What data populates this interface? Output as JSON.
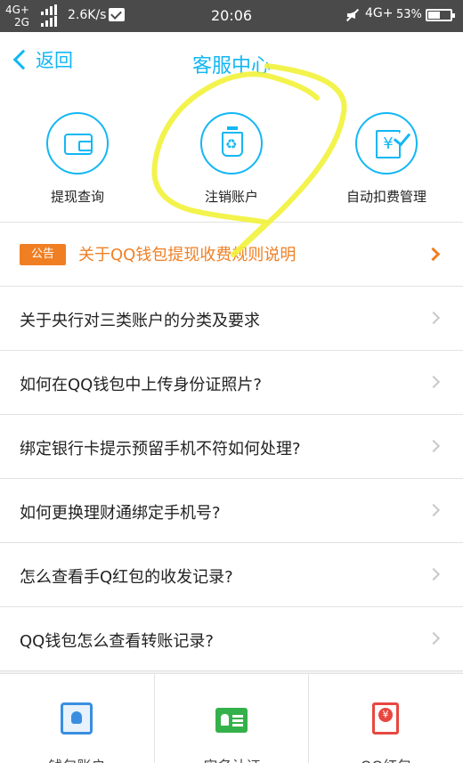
{
  "status_bar": {
    "network_left_1": "4G+",
    "network_left_2": "2G",
    "speed": "2.6K/s",
    "time": "20:06",
    "network_right": "4G+",
    "battery": "53%"
  },
  "header": {
    "back_label": "返回",
    "title": "客服中心"
  },
  "quick_actions": [
    {
      "label": "提现查询",
      "icon": "wallet-icon"
    },
    {
      "label": "注销账户",
      "icon": "recycle-bin-icon"
    },
    {
      "label": "自动扣费管理",
      "icon": "yuan-bill-icon"
    }
  ],
  "notice": {
    "badge": "公告",
    "text": "关于QQ钱包提现收费规则说明"
  },
  "faq": [
    "关于央行对三类账户的分类及要求",
    "如何在QQ钱包中上传身份证照片?",
    "绑定银行卡提示预留手机不符如何处理?",
    "如何更换理财通绑定手机号?",
    "怎么查看手Q红包的收发记录?",
    "QQ钱包怎么查看转账记录?"
  ],
  "bottom_nav": [
    {
      "label": "钱包账户",
      "icon": "wallet-account-icon"
    },
    {
      "label": "实名认证",
      "icon": "id-card-icon"
    },
    {
      "label": "QQ红包",
      "icon": "red-packet-icon"
    }
  ],
  "colors": {
    "accent": "#12b7f5",
    "notice": "#f07f23",
    "highlight": "#f2f23a"
  }
}
